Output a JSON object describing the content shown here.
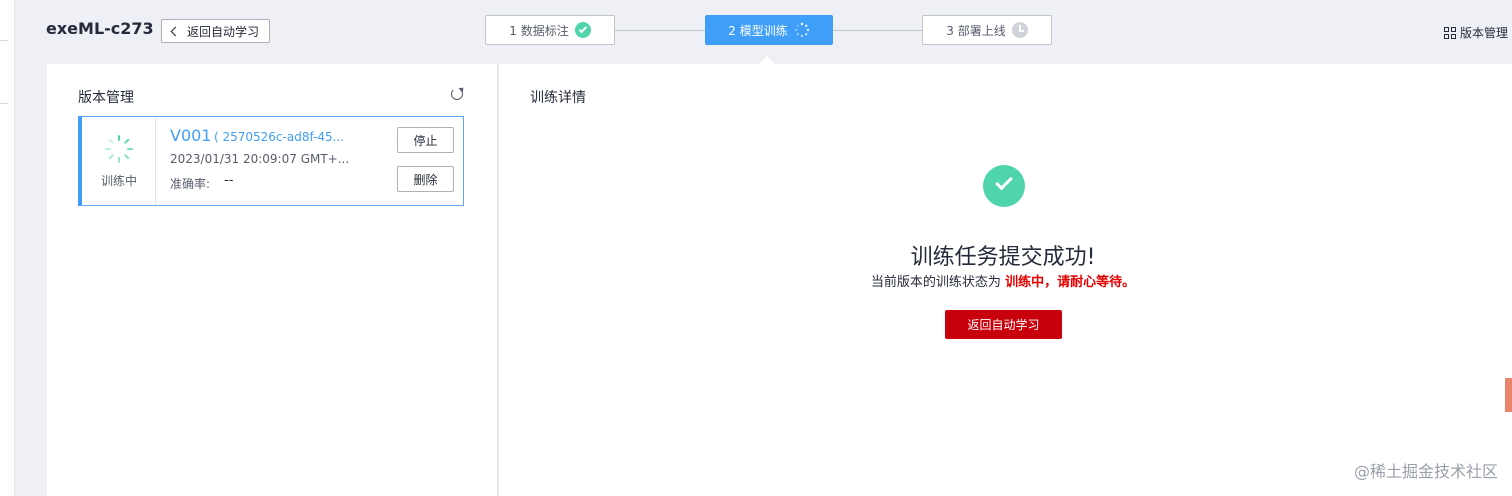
{
  "header": {
    "title": "exeML-c273",
    "back_label": "返回自动学习",
    "version_mgmt_label": "版本管理"
  },
  "steps": [
    {
      "label": "1 数据标注",
      "state": "done"
    },
    {
      "label": "2 模型训练",
      "state": "active"
    },
    {
      "label": "3 部署上线",
      "state": "pending"
    }
  ],
  "left_panel": {
    "title": "版本管理",
    "version": {
      "status": "训练中",
      "name": "V001",
      "id": "( 2570526c-ad8f-45...",
      "time": "2023/01/31 20:09:07 GMT+...",
      "accuracy_label": "准确率:",
      "accuracy_value": "--",
      "stop_label": "停止",
      "delete_label": "删除"
    }
  },
  "right_panel": {
    "title": "训练详情",
    "success_title": "训练任务提交成功!",
    "desc_prefix": "当前版本的训练状态为 ",
    "desc_highlight": "训练中，请耐心等待。",
    "button_label": "返回自动学习"
  },
  "watermark": "@稀土掘金技术社区",
  "colors": {
    "accent_blue": "#3f9ff8",
    "success_green": "#50d4ab",
    "primary_red": "#c7000b",
    "highlight_red": "#e30000"
  }
}
